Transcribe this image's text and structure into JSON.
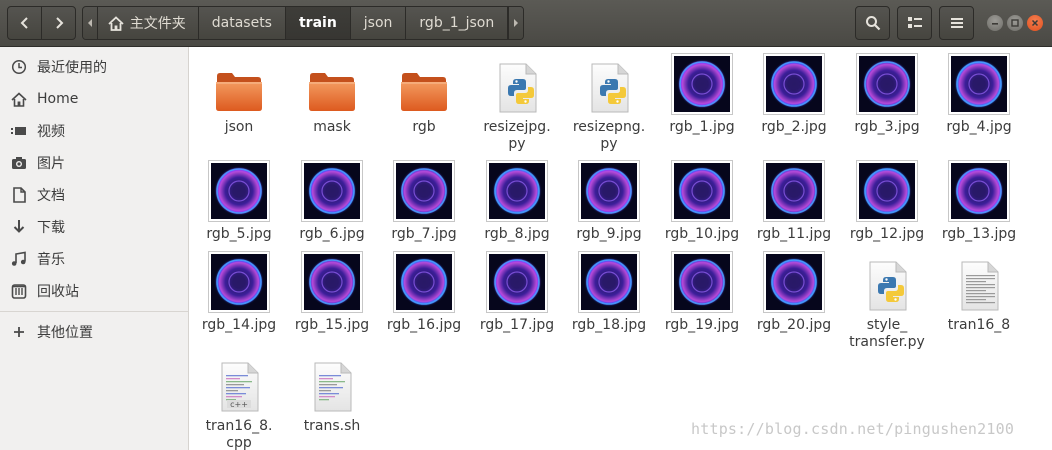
{
  "header": {
    "breadcrumbs": [
      "主文件夹",
      "datasets",
      "train",
      "json",
      "rgb_1_json"
    ],
    "current_crumb_index": 2
  },
  "sidebar": {
    "items": [
      {
        "label": "最近使用的",
        "icon": "clock-icon"
      },
      {
        "label": "Home",
        "icon": "home-icon"
      },
      {
        "label": "视频",
        "icon": "video-icon"
      },
      {
        "label": "图片",
        "icon": "camera-icon"
      },
      {
        "label": "文档",
        "icon": "document-icon"
      },
      {
        "label": "下载",
        "icon": "download-icon"
      },
      {
        "label": "音乐",
        "icon": "music-icon"
      },
      {
        "label": "回收站",
        "icon": "trash-icon"
      }
    ],
    "other_locations": {
      "label": "其他位置",
      "icon": "plus-icon"
    }
  },
  "files": [
    {
      "name": "json",
      "type": "folder"
    },
    {
      "name": "mask",
      "type": "folder"
    },
    {
      "name": "rgb",
      "type": "folder"
    },
    {
      "name": "resizejpg.py",
      "display": [
        "resizejpg.",
        "py"
      ],
      "type": "python"
    },
    {
      "name": "resizepng.py",
      "display": [
        "resizepng.",
        "py"
      ],
      "type": "python"
    },
    {
      "name": "rgb_1.jpg",
      "type": "image"
    },
    {
      "name": "rgb_2.jpg",
      "type": "image"
    },
    {
      "name": "rgb_3.jpg",
      "type": "image"
    },
    {
      "name": "rgb_4.jpg",
      "type": "image"
    },
    {
      "name": "rgb_5.jpg",
      "type": "image"
    },
    {
      "name": "rgb_6.jpg",
      "type": "image"
    },
    {
      "name": "rgb_7.jpg",
      "type": "image"
    },
    {
      "name": "rgb_8.jpg",
      "type": "image"
    },
    {
      "name": "rgb_9.jpg",
      "type": "image"
    },
    {
      "name": "rgb_10.jpg",
      "type": "image"
    },
    {
      "name": "rgb_11.jpg",
      "type": "image"
    },
    {
      "name": "rgb_12.jpg",
      "type": "image"
    },
    {
      "name": "rgb_13.jpg",
      "type": "image"
    },
    {
      "name": "rgb_14.jpg",
      "type": "image"
    },
    {
      "name": "rgb_15.jpg",
      "type": "image"
    },
    {
      "name": "rgb_16.jpg",
      "type": "image"
    },
    {
      "name": "rgb_17.jpg",
      "type": "image"
    },
    {
      "name": "rgb_18.jpg",
      "type": "image"
    },
    {
      "name": "rgb_19.jpg",
      "type": "image"
    },
    {
      "name": "rgb_20.jpg",
      "type": "image"
    },
    {
      "name": "style_transfer.py",
      "display": [
        "style_",
        "transfer.py"
      ],
      "type": "python"
    },
    {
      "name": "tran16_8",
      "type": "text"
    },
    {
      "name": "tran16_8.cpp",
      "display": [
        "tran16_8.",
        "cpp"
      ],
      "type": "cpp"
    },
    {
      "name": "trans.sh",
      "type": "shell"
    }
  ],
  "watermark": "https://blog.csdn.net/pingushen2100",
  "colors": {
    "header_bg": "#4a4944",
    "folder_orange": "#e8662c",
    "close_button": "#e95420",
    "sidebar_bg": "#f1f0ef"
  }
}
